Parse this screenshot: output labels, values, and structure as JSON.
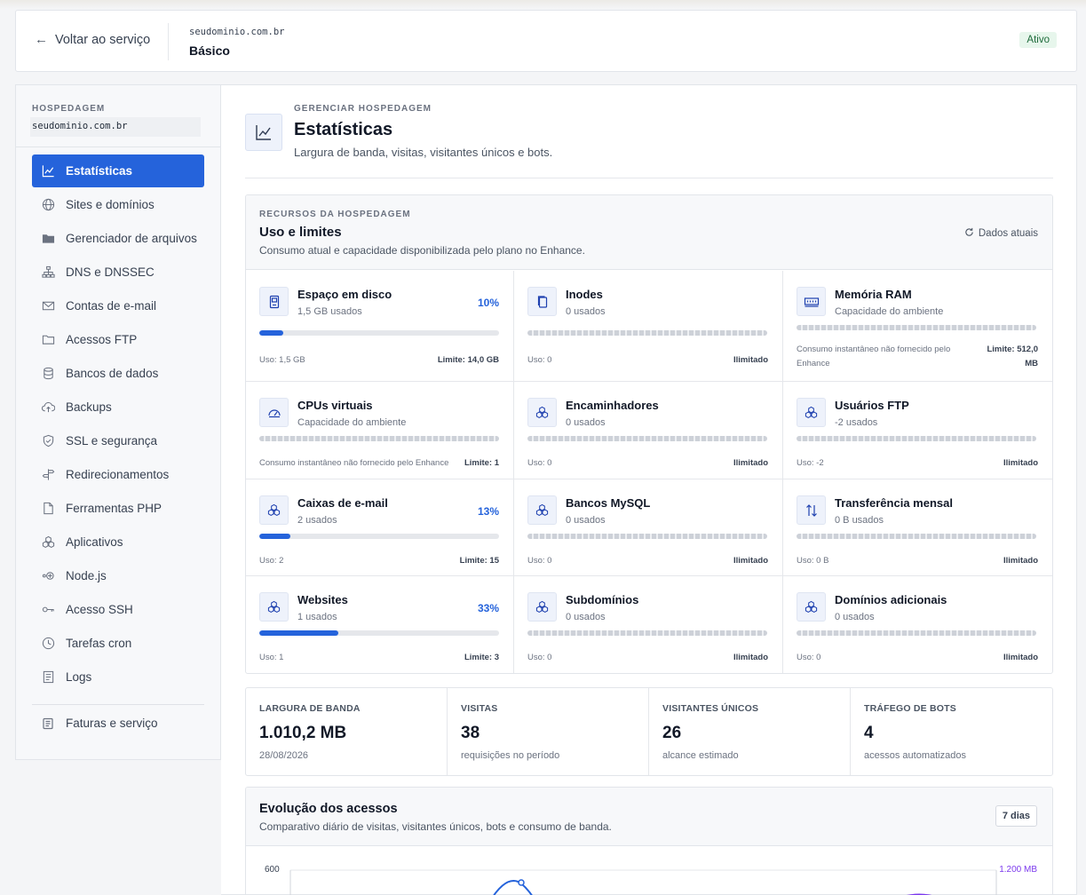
{
  "header": {
    "back_label": "Voltar ao serviço",
    "domain": "seudominio.com.br",
    "plan": "Básico",
    "status": "Ativo"
  },
  "sidebar": {
    "heading": "HOSPEDAGEM",
    "domain": "seudominio.com.br",
    "items": [
      {
        "label": "Estatísticas",
        "icon": "chart-line-icon",
        "active": true
      },
      {
        "label": "Sites e domínios",
        "icon": "globe-icon"
      },
      {
        "label": "Gerenciador de arquivos",
        "icon": "folder-filled-icon"
      },
      {
        "label": "DNS e DNSSEC",
        "icon": "network-icon"
      },
      {
        "label": "Contas de e-mail",
        "icon": "mail-icon"
      },
      {
        "label": "Acessos FTP",
        "icon": "folder-icon"
      },
      {
        "label": "Bancos de dados",
        "icon": "database-icon"
      },
      {
        "label": "Backups",
        "icon": "cloud-upload-icon"
      },
      {
        "label": "SSL e segurança",
        "icon": "shield-icon"
      },
      {
        "label": "Redirecionamentos",
        "icon": "signpost-icon"
      },
      {
        "label": "Ferramentas PHP",
        "icon": "file-code-icon"
      },
      {
        "label": "Aplicativos",
        "icon": "cubes-icon"
      },
      {
        "label": "Node.js",
        "icon": "node-icon"
      },
      {
        "label": "Acesso SSH",
        "icon": "key-icon"
      },
      {
        "label": "Tarefas cron",
        "icon": "clock-icon"
      },
      {
        "label": "Logs",
        "icon": "list-file-icon"
      }
    ],
    "footer_item": {
      "label": "Faturas e serviço",
      "icon": "invoice-icon"
    }
  },
  "page": {
    "eyebrow": "GERENCIAR HOSPEDAGEM",
    "title": "Estatísticas",
    "subtitle": "Largura de banda, visitas, visitantes únicos e bots."
  },
  "resources": {
    "eyebrow": "RECURSOS DA HOSPEDAGEM",
    "title": "Uso e limites",
    "subtitle": "Consumo atual e capacidade disponibilizada pelo plano no Enhance.",
    "live_label": "Dados atuais",
    "cards": [
      {
        "name": "Espaço em disco",
        "used": "1,5 GB usados",
        "pct": "10%",
        "fill": 0.1,
        "left": "Uso: 1,5 GB",
        "right": "Limite: 14,0 GB",
        "icon": "disk-icon"
      },
      {
        "name": "Inodes",
        "used": "0 usados",
        "pct": "",
        "fill": null,
        "left": "Uso: 0",
        "right": "Ilimitado",
        "icon": "files-icon"
      },
      {
        "name": "Memória RAM",
        "used": "Capacidade do ambiente",
        "pct": "",
        "fill": null,
        "left": "Consumo instantâneo não fornecido pelo Enhance",
        "right": "Limite: 512,0 MB",
        "icon": "ram-icon"
      },
      {
        "name": "CPUs virtuais",
        "used": "Capacidade do ambiente",
        "pct": "",
        "fill": null,
        "left": "Consumo instantâneo não fornecido pelo Enhance",
        "right": "Limite: 1",
        "icon": "gauge-icon"
      },
      {
        "name": "Encaminhadores",
        "used": "0 usados",
        "pct": "",
        "fill": null,
        "left": "Uso: 0",
        "right": "Ilimitado",
        "icon": "cubes-icon"
      },
      {
        "name": "Usuários FTP",
        "used": "-2 usados",
        "pct": "",
        "fill": null,
        "left": "Uso: -2",
        "right": "Ilimitado",
        "icon": "cubes-icon"
      },
      {
        "name": "Caixas de e-mail",
        "used": "2 usados",
        "pct": "13%",
        "fill": 0.13,
        "left": "Uso: 2",
        "right": "Limite: 15",
        "icon": "cubes-icon"
      },
      {
        "name": "Bancos MySQL",
        "used": "0 usados",
        "pct": "",
        "fill": null,
        "left": "Uso: 0",
        "right": "Ilimitado",
        "icon": "cubes-icon"
      },
      {
        "name": "Transferência mensal",
        "used": "0 B usados",
        "pct": "",
        "fill": null,
        "left": "Uso: 0 B",
        "right": "Ilimitado",
        "icon": "transfer-icon"
      },
      {
        "name": "Websites",
        "used": "1 usados",
        "pct": "33%",
        "fill": 0.33,
        "left": "Uso: 1",
        "right": "Limite: 3",
        "icon": "cubes-icon"
      },
      {
        "name": "Subdomínios",
        "used": "0 usados",
        "pct": "",
        "fill": null,
        "left": "Uso: 0",
        "right": "Ilimitado",
        "icon": "cubes-icon"
      },
      {
        "name": "Domínios adicionais",
        "used": "0 usados",
        "pct": "",
        "fill": null,
        "left": "Uso: 0",
        "right": "Ilimitado",
        "icon": "cubes-icon"
      }
    ]
  },
  "summary": [
    {
      "label": "LARGURA DE BANDA",
      "value": "1.010,2 MB",
      "note": "28/08/2026"
    },
    {
      "label": "VISITAS",
      "value": "38",
      "note": "requisições no período"
    },
    {
      "label": "VISITANTES ÚNICOS",
      "value": "26",
      "note": "alcance estimado"
    },
    {
      "label": "TRÁFEGO DE BOTS",
      "value": "4",
      "note": "acessos automatizados"
    }
  ],
  "evolution": {
    "title": "Evolução dos acessos",
    "subtitle": "Comparativo diário de visitas, visitantes únicos, bots e consumo de banda.",
    "range_button": "7 dias",
    "axis_left_top": "600",
    "axis_right_top": "1.200 MB"
  },
  "colors": {
    "accent": "#2563db",
    "purple": "#7c3aed",
    "status_green_bg": "#e7f6ec"
  }
}
